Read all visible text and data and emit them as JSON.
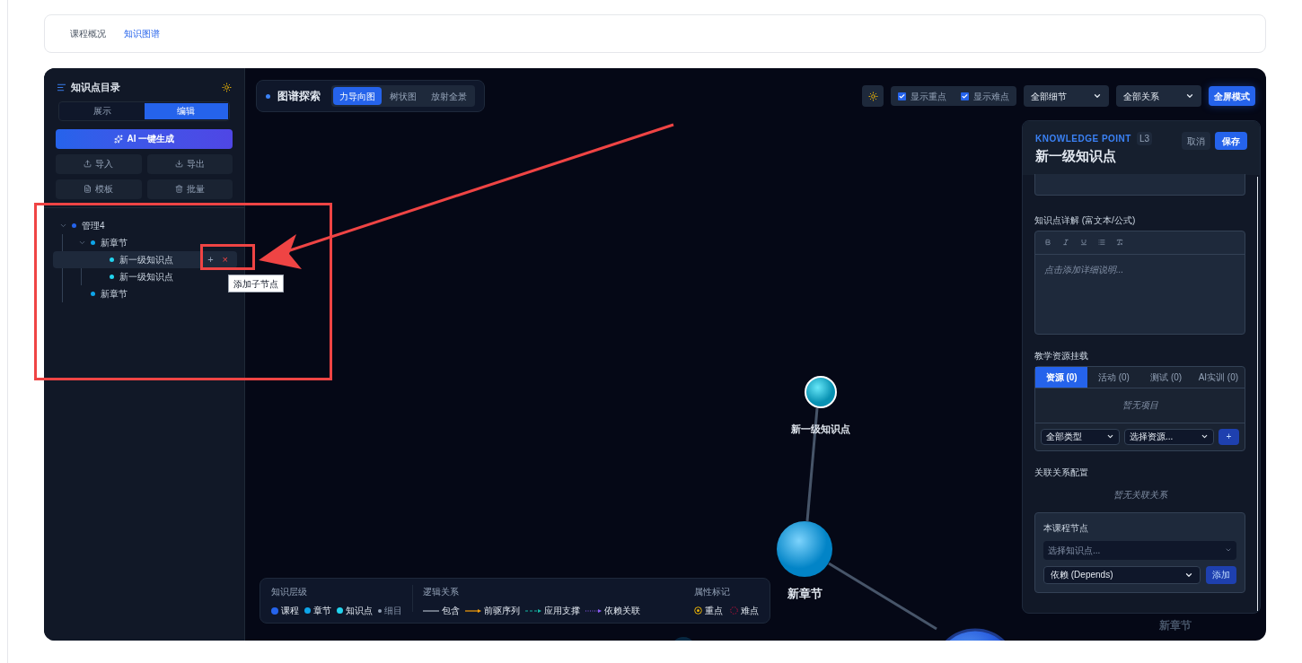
{
  "page_tabs": [
    {
      "label": "课程概况",
      "selected": false
    },
    {
      "label": "知识图谱",
      "selected": true
    }
  ],
  "sidebar": {
    "title": "知识点目录",
    "mode_tabs": [
      {
        "label": "展示",
        "selected": false
      },
      {
        "label": "编辑",
        "selected": true
      }
    ],
    "ai_button": "AI 一键生成",
    "actions": [
      {
        "label": "导入",
        "kind": "upload"
      },
      {
        "label": "导出",
        "kind": "download"
      },
      {
        "label": "模板",
        "kind": "file"
      },
      {
        "label": "批量",
        "kind": "trash"
      }
    ],
    "tree": [
      {
        "label": "管理4",
        "kind": "course",
        "expanded": true,
        "selected": false,
        "children": [
          {
            "label": "新章节",
            "kind": "chapter",
            "expanded": true,
            "selected": false,
            "children": [
              {
                "label": "新一级知识点",
                "kind": "point",
                "selected": true
              },
              {
                "label": "新一级知识点",
                "kind": "point",
                "selected": false
              }
            ]
          },
          {
            "label": "新章节",
            "kind": "chapter",
            "selected": false
          }
        ]
      }
    ],
    "row_actions": {
      "add": "+",
      "remove": "×"
    },
    "tooltip": "添加子节点"
  },
  "toolbar": {
    "title": "图谱探索",
    "views": [
      {
        "label": "力导向图",
        "selected": true
      },
      {
        "label": "树状图",
        "selected": false
      },
      {
        "label": "放射全景",
        "selected": false
      }
    ],
    "checkboxes": [
      {
        "label": "显示重点",
        "checked": true
      },
      {
        "label": "显示难点",
        "checked": true
      }
    ],
    "selects": [
      "全部细节",
      "全部关系"
    ],
    "fullscreen": "全屏模式"
  },
  "graph": {
    "nodes": [
      {
        "label": "新一级知识点",
        "kind": "point"
      },
      {
        "label": "新章节",
        "kind": "chapter"
      },
      {
        "label": "新章节",
        "kind": "hidden"
      }
    ]
  },
  "legend": {
    "levels_title": "知识层级",
    "levels": [
      {
        "label": "课程",
        "color": "#2563eb"
      },
      {
        "label": "章节",
        "color": "#0ea5e9"
      },
      {
        "label": "知识点",
        "color": "#22d3ee"
      },
      {
        "label": "细目",
        "color": "#94a3b8"
      }
    ],
    "relations_title": "逻辑关系",
    "relations": [
      {
        "label": "包含",
        "kind": "solid"
      },
      {
        "label": "前驱序列",
        "kind": "arrow"
      },
      {
        "label": "应用支撑",
        "kind": "dashed"
      },
      {
        "label": "依赖关联",
        "kind": "dotted"
      }
    ],
    "markers_title": "属性标记",
    "markers": [
      {
        "label": "重点",
        "kind": "key"
      },
      {
        "label": "难点",
        "kind": "difficult"
      }
    ]
  },
  "editor": {
    "eyebrow": "KNOWLEDGE POINT",
    "level": "L3",
    "title": "新一级知识点",
    "cancel": "取消",
    "save": "保存",
    "detail_label": "知识点详解 (富文本/公式)",
    "detail_placeholder": "点击添加详细说明...",
    "resources_label": "教学资源挂载",
    "resource_tabs": [
      {
        "label": "资源 (0)",
        "selected": true
      },
      {
        "label": "活动 (0)",
        "selected": false
      },
      {
        "label": "测试 (0)",
        "selected": false
      },
      {
        "label": "AI实训 (0)",
        "selected": false
      }
    ],
    "resources_empty": "暂无项目",
    "type_select": "全部类型",
    "resource_select": "选择资源...",
    "resource_add": "+",
    "relations_label": "关联关系配置",
    "relations_empty": "暂无关联关系",
    "course_nodes": {
      "title": "本课程节点",
      "placeholder": "选择知识点...",
      "relation_type": "依赖 (Depends)",
      "add": "添加"
    }
  }
}
